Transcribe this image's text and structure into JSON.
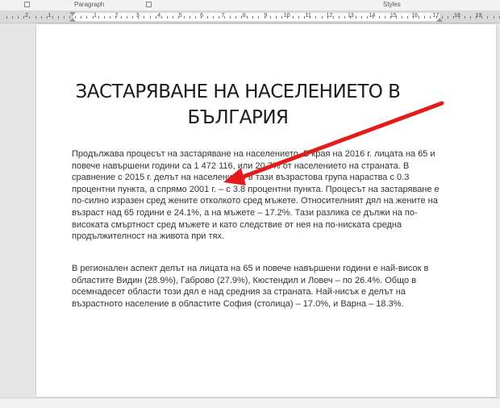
{
  "ribbon": {
    "groups": [
      "Paragraph",
      "Styles"
    ]
  },
  "ruler": {
    "left_numbers": [
      "2",
      "1"
    ],
    "numbers": [
      "1",
      "2",
      "3",
      "4",
      "5",
      "6",
      "7",
      "8",
      "9",
      "10",
      "11",
      "12",
      "13",
      "14",
      "15",
      "16"
    ],
    "right_numbers": [
      "17",
      "18",
      "19"
    ]
  },
  "document": {
    "title": "ЗАСТАРЯВАНЕ НА НАСЕЛЕНИЕТО В БЪЛГАРИЯ",
    "paragraphs": [
      "Продължава процесът на застаряване на населението. В края на 2016 г. лицата на 65 и повече навършени години са 1 472 116, или 20.7% от населението на страната. В сравнение с 2015 г. делът на населението в тази възрастова група нараства с 0.3 процентни пункта, а спрямо 2001 г. – с 3.8 процентни пункта. Процесът на застаряване е по-силно изразен сред жените отколкото сред мъжете. Относителният дял на жените на възраст над 65 години е 24.1%, а на мъжете – 17.2%. Тази разлика се дължи на по-високата смъртност сред мъжете и като следствие от нея на по-ниската средна продължителност на живота при тях.",
      "В регионален аспект делът на лицата на 65 и повече навършени години е най-висок в областите Видин (28.9%), Габрово (27.9%), Кюстендил и Ловеч – по 26.4%. Общо в осемнадесет области този дял е над средния за страната. Най-нисък е делът на възрастното население в областите София (столица) – 17.0%, и Варна – 18.3%."
    ]
  },
  "annotation": {
    "arrow_color": "#e31b1b"
  }
}
